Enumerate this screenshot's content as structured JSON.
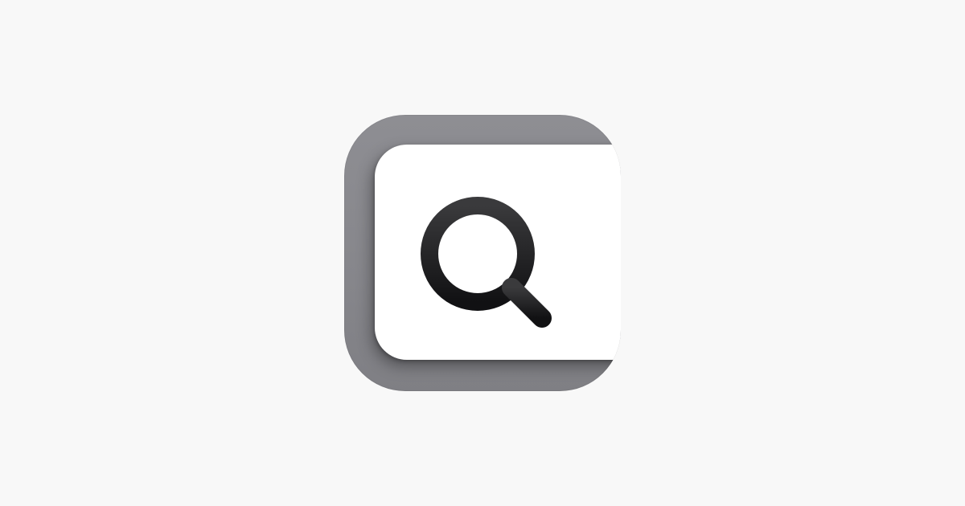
{
  "screen": {
    "background_color": "#f8f8f8"
  },
  "app_icon": {
    "icon": "magnifying-glass-icon",
    "tile_color": "#8e8e93",
    "card_color": "#ffffff",
    "glyph_color": "#1c1c1e"
  }
}
